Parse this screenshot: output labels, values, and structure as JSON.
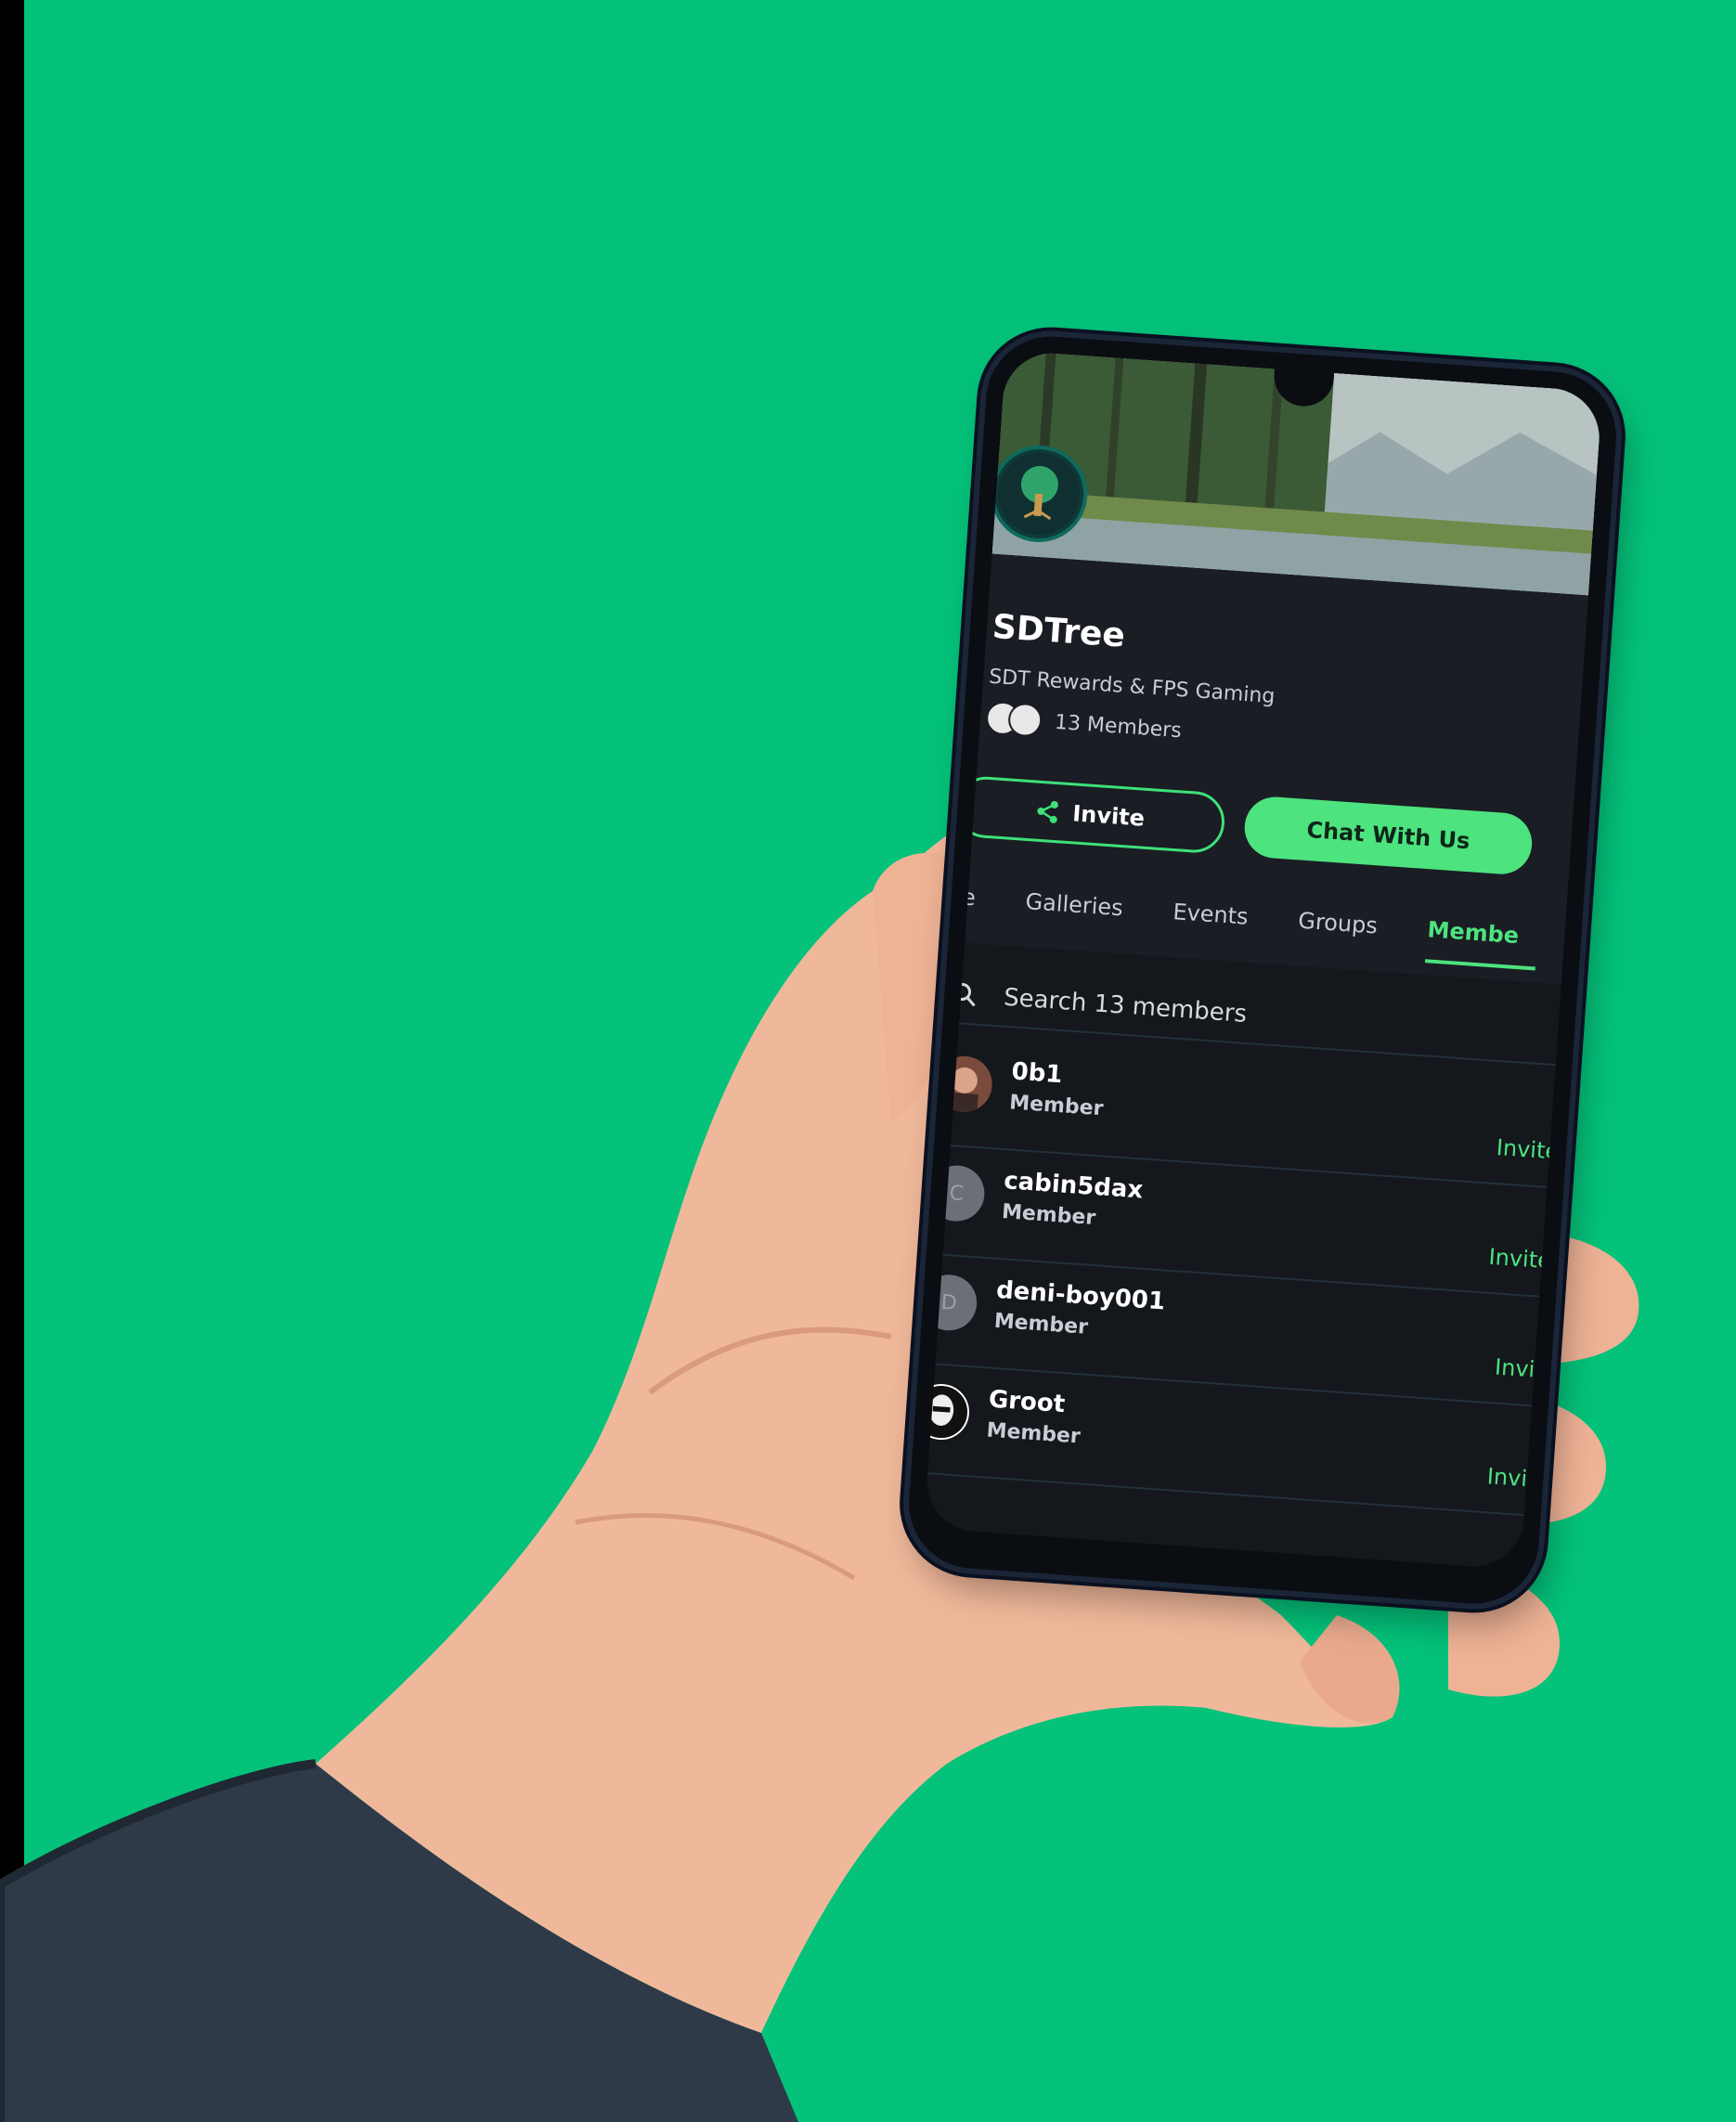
{
  "colors": {
    "background": "#04c27a",
    "accent": "#4de37f",
    "screen": "#1a1d23"
  },
  "group": {
    "name": "SDTree",
    "tagline": "SDT Rewards & FPS Gaming",
    "members_label": "13 Members"
  },
  "actions": {
    "invite_label": "Invite",
    "invite_icon": "share-icon",
    "chat_label": "Chat With Us"
  },
  "tabs": [
    {
      "label": "me",
      "active": false
    },
    {
      "label": "Galleries",
      "active": false
    },
    {
      "label": "Events",
      "active": false
    },
    {
      "label": "Groups",
      "active": false
    },
    {
      "label": "Membe",
      "active": true
    }
  ],
  "search": {
    "icon": "search-icon",
    "placeholder": "Search 13 members"
  },
  "members": [
    {
      "name": "0b1",
      "role": "Member",
      "action": "Invite",
      "avatar": "photo",
      "initial": ""
    },
    {
      "name": "cabin5dax",
      "role": "Member",
      "action": "Invite",
      "avatar": "letter",
      "initial": "C"
    },
    {
      "name": "deni-boy001",
      "role": "Member",
      "action": "Invit",
      "avatar": "letter",
      "initial": "D"
    },
    {
      "name": "Groot",
      "role": "Member",
      "action": "Invit",
      "avatar": "dark",
      "initial": ""
    }
  ]
}
